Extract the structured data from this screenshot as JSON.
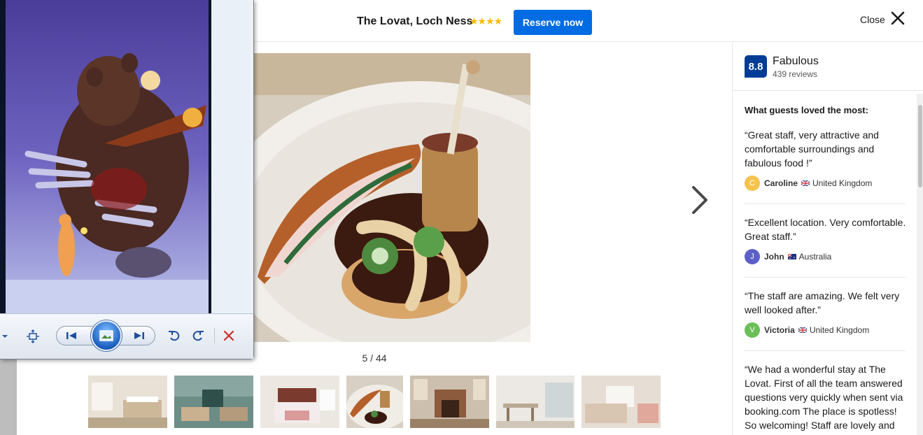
{
  "header": {
    "hotel_name": "The Lovat, Loch Ness",
    "stars": "★★★★",
    "reserve_label": "Reserve now",
    "close_label": "Close"
  },
  "gallery": {
    "counter": "5 / 44",
    "thumbnails": [
      {
        "name": "thumb-bedroom-twin",
        "selected": false
      },
      {
        "name": "thumb-lounge",
        "selected": false
      },
      {
        "name": "thumb-bedroom-pink",
        "selected": false
      },
      {
        "name": "thumb-dish",
        "selected": true
      },
      {
        "name": "thumb-fireplace",
        "selected": false
      },
      {
        "name": "thumb-dining-room",
        "selected": false
      },
      {
        "name": "thumb-bedroom-window",
        "selected": false
      }
    ]
  },
  "rating": {
    "score": "8.8",
    "word": "Fabulous",
    "reviews": "439 reviews"
  },
  "guests_loved": {
    "title": "What guests loved the most:",
    "reviews": [
      {
        "text": "“Great staff, very attractive and comfortable surroundings and fabulous food !”",
        "initial": "C",
        "name": "Caroline",
        "country": "United Kingdom",
        "avatar_color": "#f5c24b"
      },
      {
        "text": "“Excellent location. Very comfortable. Great staff.”",
        "initial": "J",
        "name": "John",
        "country": "Australia",
        "avatar_color": "#5b5fc7"
      },
      {
        "text": "“The staff are amazing. We felt very well looked after.”",
        "initial": "V",
        "name": "Victoria",
        "country": "United Kingdom",
        "avatar_color": "#6bbf59"
      },
      {
        "text": "“We had a wonderful stay at The Lovat. First of all the team answered questions very quickly when sent via booking.com The place is spotless! So welcoming! Staff are lovely and",
        "initial": "",
        "name": "",
        "country": "",
        "avatar_color": ""
      }
    ]
  },
  "colors": {
    "brand_blue": "#006ce4",
    "score_blue": "#003b95",
    "star_yellow": "#febb02"
  }
}
